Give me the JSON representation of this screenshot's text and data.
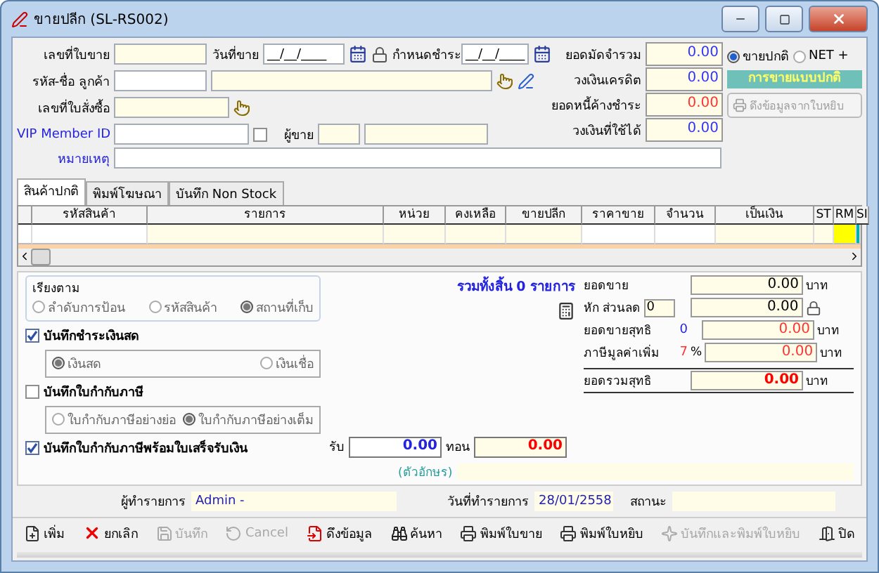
{
  "window": {
    "title": "ขายปลีก (SL-RS002)"
  },
  "form": {
    "sale_no": {
      "label": "เลขที่ใบขาย"
    },
    "sale_date": {
      "label": "วันที่ขาย",
      "value": "__/__/____"
    },
    "due_date": {
      "label": "กำหนดชำระ",
      "value": "__/__/____"
    },
    "customer": {
      "label": "รหัส-ชื่อ ลูกค้า"
    },
    "po_no": {
      "label": "เลขที่ใบสั่งซื้อ"
    },
    "vip": {
      "label": "VIP Member ID",
      "checked": false
    },
    "seller": {
      "label": "ผู้ขาย"
    },
    "note": {
      "label": "หมายเหตุ"
    }
  },
  "balances": [
    {
      "label": "ยอดมัดจำรวม",
      "value": "0.00",
      "color": "#3333ff"
    },
    {
      "label": "วงเงินเครดิต",
      "value": "0.00",
      "color": "#3333ff"
    },
    {
      "label": "ยอดหนี้ค้างชำระ",
      "value": "0.00",
      "color": "#ff3333"
    },
    {
      "label": "วงเงินที่ใช้ได้",
      "value": "0.00",
      "color": "#3333ff"
    }
  ],
  "sale_mode": {
    "options": [
      {
        "label": "ขายปกติ",
        "selected": true
      },
      {
        "label": "NET +",
        "selected": false
      }
    ],
    "banner": "การขายแบบปกติ",
    "pull_button": {
      "label": "ดึงข้อมูลจากใบหยิบ",
      "disabled": true
    }
  },
  "tabs": [
    {
      "label": "สินค้าปกติ",
      "selected": true
    },
    {
      "label": "พิมพ์โฆษณา",
      "selected": false
    },
    {
      "label": "บันทึก Non Stock",
      "selected": false
    }
  ],
  "table": {
    "columns": [
      {
        "label": "รหัสสินค้า"
      },
      {
        "label": "รายการ"
      },
      {
        "label": "หน่วย"
      },
      {
        "label": "คงเหลือ"
      },
      {
        "label": "ขายปลีก"
      },
      {
        "label": "ราคาขาย"
      },
      {
        "label": "จำนวน"
      },
      {
        "label": "เป็นเงิน"
      },
      {
        "label": "ST"
      },
      {
        "label": "RM",
        "color": "#ffff00"
      },
      {
        "label": "SI",
        "color": "#00b0b0"
      }
    ]
  },
  "sort": {
    "label": "เรียงตาม",
    "options": [
      {
        "label": "ลำดับการป้อน",
        "selected": false
      },
      {
        "label": "รหัสสินค้า",
        "selected": false
      },
      {
        "label": "สถานที่เก็บ",
        "selected": true
      }
    ]
  },
  "options": [
    {
      "label": "บันทึกชำระเงินสด",
      "checked": true,
      "radios": [
        {
          "label": "เงินสด",
          "selected": true
        },
        {
          "label": "เงินเชื่อ",
          "selected": false
        }
      ]
    },
    {
      "label": "บันทึกใบกำกับภาษี",
      "checked": false,
      "radios": [
        {
          "label": "ใบกำกับภาษีอย่างย่อ",
          "selected": false
        },
        {
          "label": "ใบกำกับภาษีอย่างเต็ม",
          "selected": true
        }
      ]
    },
    {
      "label": "บันทึกใบกำกับภาษีพร้อมใบเสร็จรับเงิน",
      "checked": true
    }
  ],
  "payment": {
    "receive_label": "รับ",
    "receive": "0.00",
    "change_label": "ทอน",
    "change": "0.00",
    "words_label": "(ตัวอักษร)"
  },
  "summary": {
    "count_text": "รวมทั้งสิ้น 0 รายการ",
    "rows": [
      {
        "kind": "plain",
        "label": "ยอดขาย",
        "value": "0.00",
        "unit": "บาท",
        "color": "#000000"
      },
      {
        "kind": "discount",
        "label": "หัก ส่วนลด",
        "input": "0",
        "value": "0.00",
        "color": "#000000"
      },
      {
        "kind": "plain",
        "label": "ยอดขายสุทธิ",
        "extra": "0",
        "value": "0.00",
        "unit": "บาท",
        "color": "#ff3333"
      },
      {
        "kind": "plain",
        "label": "ภาษีมูลค่าเพิ่ม",
        "extra": "7",
        "extra2": "%",
        "value": "0.00",
        "unit": "บาท",
        "color": "#ff3333"
      },
      {
        "kind": "total",
        "label": "ยอดรวมสุทธิ",
        "value": "0.00",
        "unit": "บาท",
        "color": "#ff0000"
      }
    ]
  },
  "status": {
    "user_label": "ผู้ทำรายการ",
    "user": "Admin -",
    "date_label": "วันที่ทำรายการ",
    "date": "28/01/2558",
    "state_label": "สถานะ"
  },
  "toolbar": [
    {
      "kind": "new",
      "label": "เพิ่ม",
      "disabled": false
    },
    {
      "kind": "cancel",
      "label": "ยกเลิก",
      "disabled": false
    },
    {
      "kind": "save",
      "label": "บันทึก",
      "disabled": true
    },
    {
      "kind": "undo",
      "label": "Cancel",
      "disabled": true
    },
    {
      "kind": "import",
      "label": "ดึงข้อมูล",
      "disabled": false
    },
    {
      "kind": "find",
      "label": "ค้นหา",
      "disabled": false
    },
    {
      "kind": "print",
      "label": "พิมพ์ใบขาย",
      "disabled": false
    },
    {
      "kind": "print",
      "label": "พิมพ์ใบหยิบ",
      "disabled": false
    },
    {
      "kind": "spark",
      "label": "บันทึกและพิมพ์ใบหยิบ",
      "disabled": true
    },
    {
      "kind": "exit",
      "label": "ปิด",
      "disabled": false
    }
  ]
}
